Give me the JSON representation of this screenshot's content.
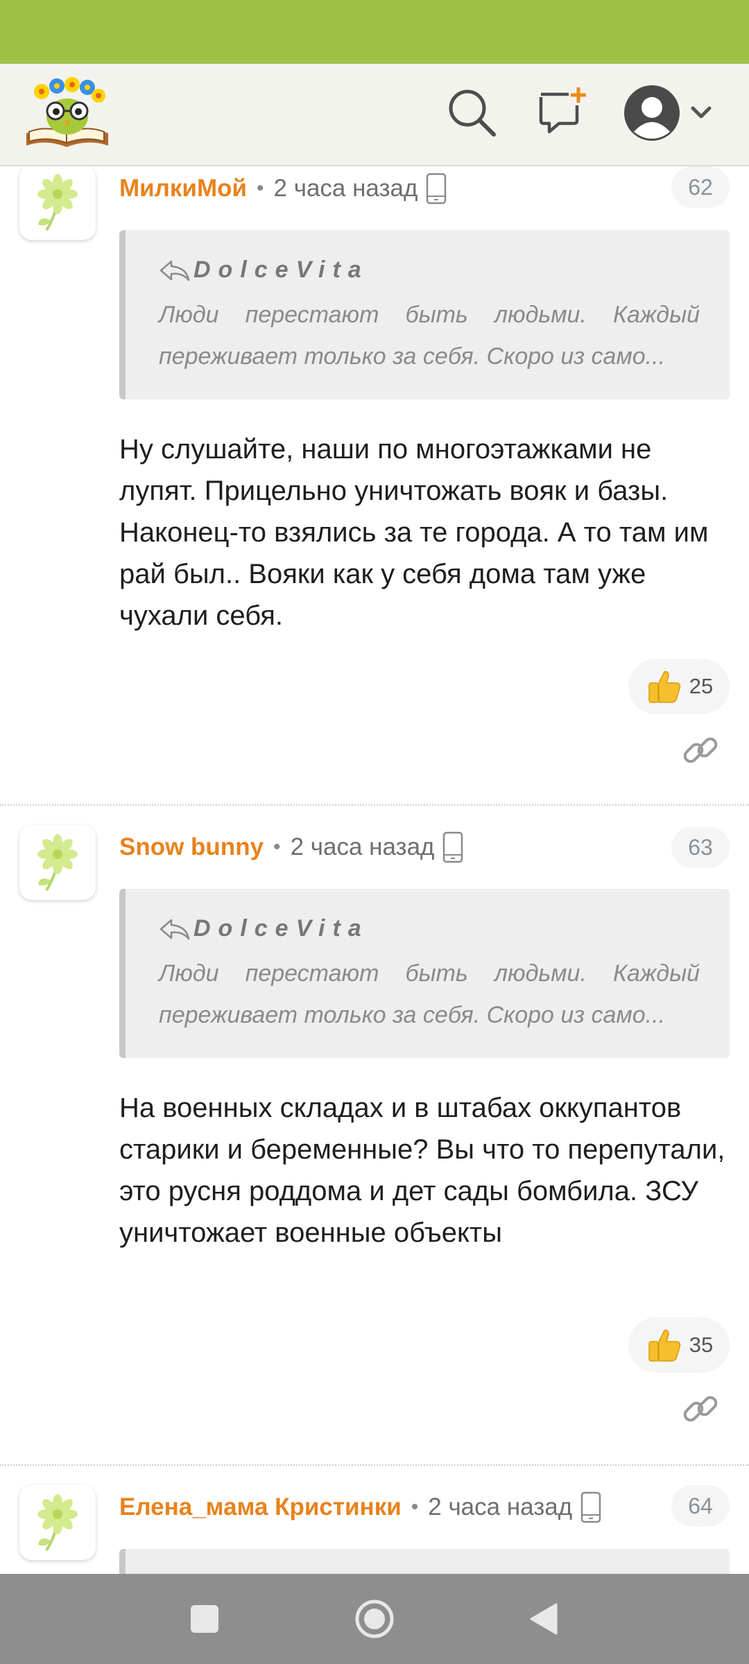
{
  "colors": {
    "status_bar": "#9dc144",
    "header_bg": "#f3f3ee",
    "author": "#e8821c",
    "quote_bg": "#eeeeee",
    "nav_bar": "#8e8e8e"
  },
  "header": {
    "logo_icon": "owl-on-book-logo",
    "search_icon": "search-icon",
    "new_post_icon": "chat-plus-icon",
    "profile_icon": "user-avatar-icon",
    "dropdown_icon": "chevron-down-icon"
  },
  "comments": [
    {
      "number": "62",
      "author": "МилкиМой",
      "separator": "•",
      "time": "2 часа назад",
      "device_icon": "phone-icon",
      "quote": {
        "author": "DolceVita",
        "line1": "Люди перестают быть людьми. Каждый",
        "line2": "переживает только за себя. Скоро из само..."
      },
      "text": "Ну слушайте, наши по многоэтажками не лупят. Прицельно уничтожать вояк и базы. Наконец-то взялись за те города. А то там им рай был.. Вояки как у себя дома там уже чухали себя.",
      "likes": "25"
    },
    {
      "number": "63",
      "author": "Snow bunny",
      "separator": "•",
      "time": "2 часа назад",
      "device_icon": "phone-icon",
      "quote": {
        "author": "DolceVita",
        "line1": "Люди перестают быть людьми. Каждый",
        "line2": "переживает только за себя. Скоро из само..."
      },
      "text": "На военных складах и в штабах оккупантов старики и беременные? Вы что то перепутали, это русня роддома и дет сады бомбила. ЗСУ уничтожает военные объекты",
      "likes": "35"
    },
    {
      "number": "64",
      "author": "Елена_мама Кристинки",
      "separator": "•",
      "time": "2 часа назад",
      "device_icon": "phone-icon"
    }
  ],
  "nav": {
    "recents_icon": "square-icon",
    "home_icon": "circle-icon",
    "back_icon": "triangle-back-icon"
  }
}
